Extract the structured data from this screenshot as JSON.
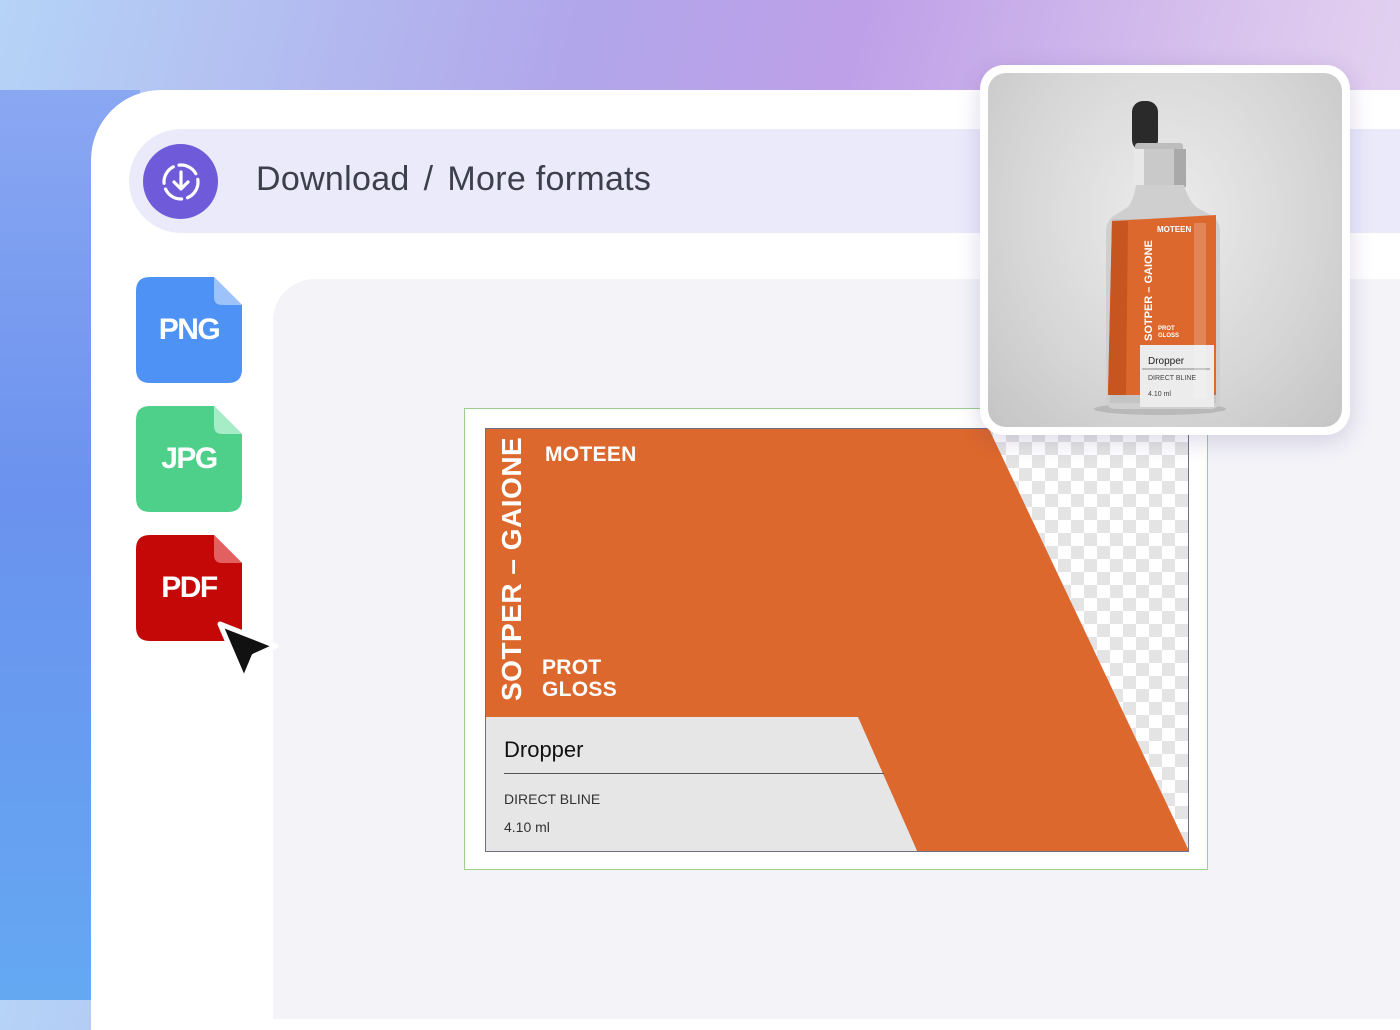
{
  "breadcrumb": {
    "current": "Download",
    "separator": "/",
    "next": "More formats"
  },
  "formats": [
    {
      "label": "PNG",
      "color": "#4e92f5",
      "fold_color": "#9ec3fb"
    },
    {
      "label": "JPG",
      "color": "#4ecf8a",
      "fold_color": "#a6ecc6"
    },
    {
      "label": "PDF",
      "color": "#c40808",
      "fold_color": "#e26060"
    }
  ],
  "label_design": {
    "vertical_title": "SOTPER – GAIONE",
    "brand": "MOTEEN",
    "subtitle_line1": "PROT",
    "subtitle_line2": "GLOSS",
    "product_name": "Dropper",
    "line1": "DIRECT BLINE",
    "volume": "4.10 ml",
    "accent_color": "#dd682d",
    "panel_color": "#e6e6e6"
  },
  "icons": {
    "download": "download-icon",
    "cursor": "cursor-icon"
  },
  "colors": {
    "brand_purple": "#6f5bd9",
    "header_bg": "#ebeafb"
  }
}
